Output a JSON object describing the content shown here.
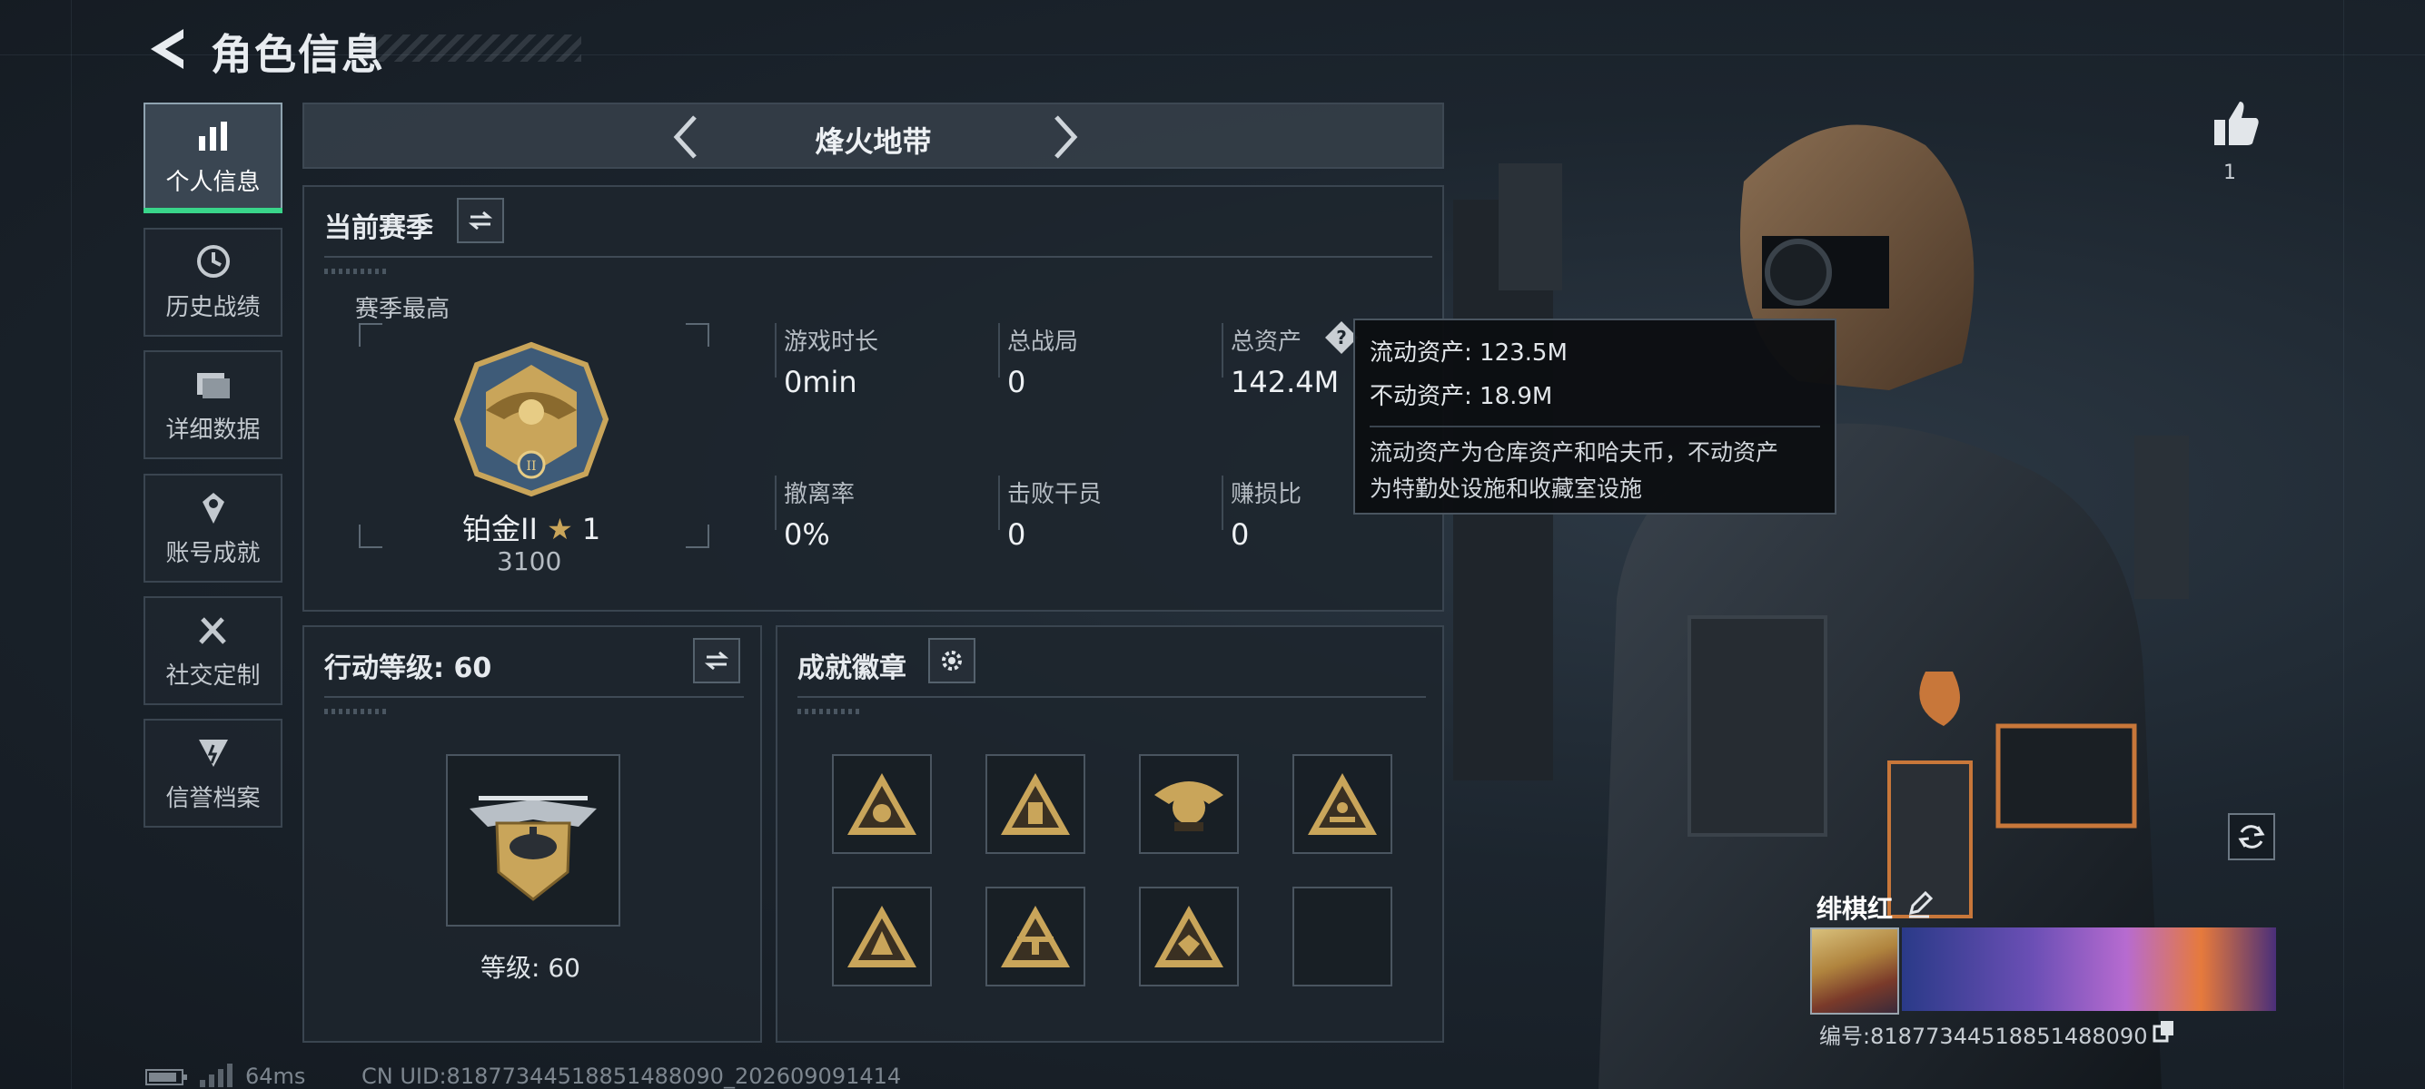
{
  "header": {
    "title": "角色信息"
  },
  "sidebar": {
    "items": [
      {
        "label": "个人信息",
        "icon": "bar-chart-icon",
        "active": true
      },
      {
        "label": "历史战绩",
        "icon": "clock-icon",
        "active": false
      },
      {
        "label": "详细数据",
        "icon": "folder-icon",
        "active": false
      },
      {
        "label": "账号成就",
        "icon": "trophy-icon",
        "active": false
      },
      {
        "label": "社交定制",
        "icon": "tools-icon",
        "active": false
      },
      {
        "label": "信誉档案",
        "icon": "credit-icon",
        "active": false
      }
    ]
  },
  "mode": {
    "name": "烽火地带"
  },
  "season": {
    "title": "当前赛季",
    "best_label": "赛季最高",
    "rank_name": "铂金II",
    "rank_stars": "1",
    "rank_score": "3100",
    "stats": [
      {
        "label": "游戏时长",
        "value": "0min"
      },
      {
        "label": "总战局",
        "value": "0"
      },
      {
        "label": "总资产",
        "value": "142.4M"
      },
      {
        "label": "撤离率",
        "value": "0%"
      },
      {
        "label": "击败干员",
        "value": "0"
      },
      {
        "label": "赚损比",
        "value": "0"
      }
    ]
  },
  "tooltip": {
    "liquid": "流动资产: 123.5M",
    "fixed": "不动资产: 18.9M",
    "desc_1": "流动资产为仓库资产和哈夫币，不动资产",
    "desc_2": "为特勤处设施和收藏室设施"
  },
  "action_level": {
    "title": "行动等级: 60",
    "level_text": "等级: 60"
  },
  "achievements": {
    "title": "成就徽章",
    "badges": [
      "badge-triangle-1",
      "badge-triangle-2",
      "badge-eagle",
      "badge-triangle-3",
      "badge-triangle-4",
      "badge-triangle-5",
      "badge-triangle-6",
      "empty"
    ]
  },
  "social": {
    "likes": "1",
    "player_name": "绯棋红",
    "player_id": "编号:81877344518851488090"
  },
  "footer": {
    "ping": "64ms",
    "uid": "CN UID:81877344518851488090_202609091414"
  },
  "colors": {
    "accent": "#39d58a",
    "gold": "#c9a55a",
    "panel": "#1e262e"
  }
}
